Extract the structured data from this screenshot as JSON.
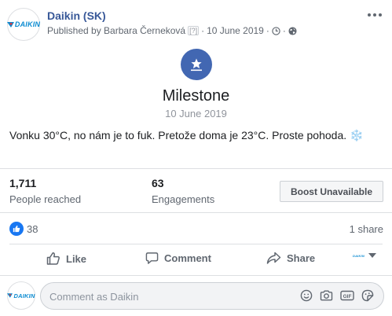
{
  "post": {
    "page_name": "Daikin (SK)",
    "brand_logo_text": "DAIKIN",
    "published_by": "Published by Barbara Černeková",
    "info_tag": "[?]",
    "date": "10 June 2019",
    "separator": "·"
  },
  "milestone": {
    "title": "Milestone",
    "date": "10 June 2019"
  },
  "body": {
    "text": "Vonku 30°C, no nám je to fuk. Pretože doma je 23°C. Proste pohoda.",
    "emoji": "❄️"
  },
  "insights": {
    "people_reached_value": "1,711",
    "people_reached_label": "People reached",
    "engagements_value": "63",
    "engagements_label": "Engagements",
    "boost_label": "Boost Unavailable"
  },
  "reactions": {
    "like_count": "38",
    "shares": "1 share"
  },
  "actions": {
    "like": "Like",
    "comment": "Comment",
    "share": "Share"
  },
  "composer": {
    "placeholder": "Comment as Daikin"
  },
  "icons": {
    "milestone": "star-flag-icon",
    "globe": "globe-icon",
    "clock": "clock-icon",
    "like_reaction": "thumbs-up-icon",
    "like_action": "thumbs-up-outline-icon",
    "comment": "speech-bubble-icon",
    "share": "share-arrow-icon",
    "emoji": "smiley-icon",
    "camera": "camera-icon",
    "gif": "gif-icon",
    "sticker": "sticker-icon"
  },
  "colors": {
    "link": "#385898",
    "accent": "#4267b2",
    "brand": "#0b8bd1",
    "reaction": "#1877f2"
  }
}
